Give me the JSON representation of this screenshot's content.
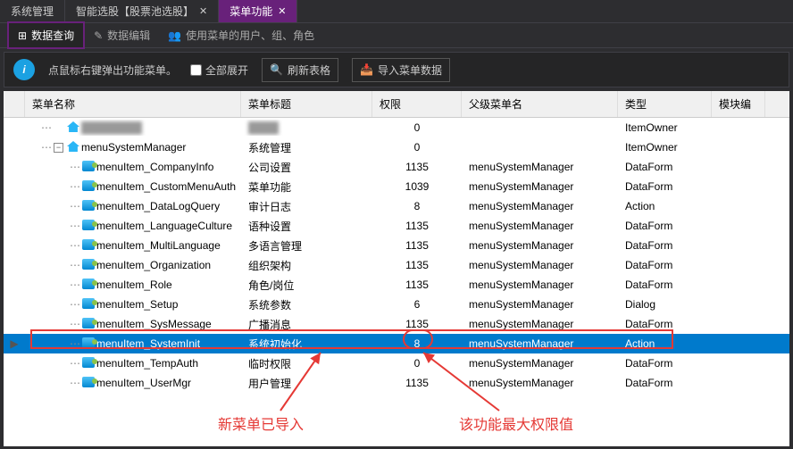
{
  "topTabs": [
    {
      "label": "系统管理",
      "active": false,
      "closable": false
    },
    {
      "label": "智能选股【股票池选股】",
      "active": false,
      "closable": true
    },
    {
      "label": "菜单功能",
      "active": true,
      "closable": true
    }
  ],
  "subTabs": [
    {
      "label": "数据查询",
      "active": true
    },
    {
      "label": "数据编辑",
      "active": false
    },
    {
      "label": "使用菜单的用户、组、角色",
      "active": false
    }
  ],
  "toolbar": {
    "hint": "点鼠标右键弹出功能菜单。",
    "expandAll": "全部展开",
    "refresh": "刷新表格",
    "import": "导入菜单数据"
  },
  "headers": {
    "name": "菜单名称",
    "title": "菜单标题",
    "auth": "权限",
    "parent": "父级菜单名",
    "type": "类型",
    "mod": "模块编"
  },
  "rows": [
    {
      "marker": "",
      "indent": 1,
      "toggle": "",
      "icon": "home",
      "name": "",
      "blurName": true,
      "title": "",
      "blurTitle": true,
      "auth": "0",
      "parent": "",
      "type": "ItemOwner",
      "sel": false
    },
    {
      "marker": "",
      "indent": 1,
      "toggle": "-",
      "icon": "home",
      "name": "menuSystemManager",
      "title": "系统管理",
      "auth": "0",
      "parent": "",
      "type": "ItemOwner",
      "sel": false
    },
    {
      "marker": "",
      "indent": 2,
      "icon": "user",
      "name": "menuItem_CompanyInfo",
      "title": "公司设置",
      "auth": "1135",
      "parent": "menuSystemManager",
      "type": "DataForm",
      "sel": false
    },
    {
      "marker": "",
      "indent": 2,
      "icon": "user",
      "name": "menuItem_CustomMenuAuth",
      "title": "菜单功能",
      "auth": "1039",
      "parent": "menuSystemManager",
      "type": "DataForm",
      "sel": false
    },
    {
      "marker": "",
      "indent": 2,
      "icon": "user",
      "name": "menuItem_DataLogQuery",
      "title": "审计日志",
      "auth": "8",
      "parent": "menuSystemManager",
      "type": "Action",
      "sel": false
    },
    {
      "marker": "",
      "indent": 2,
      "icon": "user",
      "name": "menuItem_LanguageCulture",
      "title": "语种设置",
      "auth": "1135",
      "parent": "menuSystemManager",
      "type": "DataForm",
      "sel": false
    },
    {
      "marker": "",
      "indent": 2,
      "icon": "user",
      "name": "menuItem_MultiLanguage",
      "title": "多语言管理",
      "auth": "1135",
      "parent": "menuSystemManager",
      "type": "DataForm",
      "sel": false
    },
    {
      "marker": "",
      "indent": 2,
      "icon": "user",
      "name": "menuItem_Organization",
      "title": "组织架构",
      "auth": "1135",
      "parent": "menuSystemManager",
      "type": "DataForm",
      "sel": false
    },
    {
      "marker": "",
      "indent": 2,
      "icon": "user",
      "name": "menuItem_Role",
      "title": "角色/岗位",
      "auth": "1135",
      "parent": "menuSystemManager",
      "type": "DataForm",
      "sel": false
    },
    {
      "marker": "",
      "indent": 2,
      "icon": "user",
      "name": "menuItem_Setup",
      "title": "系统参数",
      "auth": "6",
      "parent": "menuSystemManager",
      "type": "Dialog",
      "sel": false
    },
    {
      "marker": "",
      "indent": 2,
      "icon": "user",
      "name": "menuItem_SysMessage",
      "title": "广播消息",
      "auth": "1135",
      "parent": "menuSystemManager",
      "type": "DataForm",
      "sel": false
    },
    {
      "marker": "▶",
      "indent": 2,
      "icon": "user",
      "name": "menuItem_SystemInit",
      "title": "系统初始化",
      "auth": "8",
      "parent": "menuSystemManager",
      "type": "Action",
      "sel": true
    },
    {
      "marker": "",
      "indent": 2,
      "icon": "user",
      "name": "menuItem_TempAuth",
      "title": "临时权限",
      "auth": "0",
      "parent": "menuSystemManager",
      "type": "DataForm",
      "sel": false
    },
    {
      "marker": "",
      "indent": 2,
      "icon": "user",
      "name": "menuItem_UserMgr",
      "title": "用户管理",
      "auth": "1135",
      "parent": "menuSystemManager",
      "type": "DataForm",
      "sel": false
    }
  ],
  "annotations": {
    "leftText": "新菜单已导入",
    "rightText": "该功能最大权限值"
  }
}
